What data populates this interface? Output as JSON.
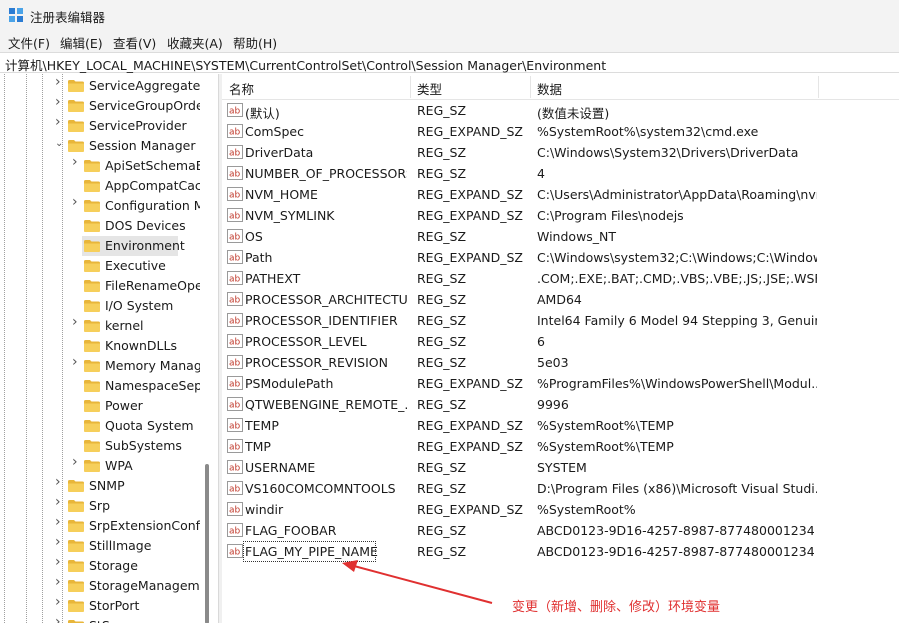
{
  "window": {
    "title": "注册表编辑器"
  },
  "menu": [
    "文件(F)",
    "编辑(E)",
    "查看(V)",
    "收藏夹(A)",
    "帮助(H)"
  ],
  "address": "计算机\\HKEY_LOCAL_MACHINE\\SYSTEM\\CurrentControlSet\\Control\\Session Manager\\Environment",
  "tree": [
    {
      "label": "ServiceAggregatedEvents",
      "level": 1,
      "chevron": "right"
    },
    {
      "label": "ServiceGroupOrder",
      "level": 1,
      "chevron": "right"
    },
    {
      "label": "ServiceProvider",
      "level": 1,
      "chevron": "right"
    },
    {
      "label": "Session Manager",
      "level": 1,
      "chevron": "down"
    },
    {
      "label": "ApiSetSchemaExtensions",
      "level": 2,
      "chevron": "right"
    },
    {
      "label": "AppCompatCache",
      "level": 2,
      "chevron": ""
    },
    {
      "label": "Configuration Manager",
      "level": 2,
      "chevron": "right"
    },
    {
      "label": "DOS Devices",
      "level": 2,
      "chevron": ""
    },
    {
      "label": "Environment",
      "level": 2,
      "chevron": "",
      "selected": true
    },
    {
      "label": "Executive",
      "level": 2,
      "chevron": ""
    },
    {
      "label": "FileRenameOperations",
      "level": 2,
      "chevron": ""
    },
    {
      "label": "I/O System",
      "level": 2,
      "chevron": ""
    },
    {
      "label": "kernel",
      "level": 2,
      "chevron": "right"
    },
    {
      "label": "KnownDLLs",
      "level": 2,
      "chevron": ""
    },
    {
      "label": "Memory Management",
      "level": 2,
      "chevron": "right"
    },
    {
      "label": "NamespaceSeparation",
      "level": 2,
      "chevron": ""
    },
    {
      "label": "Power",
      "level": 2,
      "chevron": ""
    },
    {
      "label": "Quota System",
      "level": 2,
      "chevron": ""
    },
    {
      "label": "SubSystems",
      "level": 2,
      "chevron": ""
    },
    {
      "label": "WPA",
      "level": 2,
      "chevron": "right"
    },
    {
      "label": "SNMP",
      "level": 1,
      "chevron": "right"
    },
    {
      "label": "Srp",
      "level": 1,
      "chevron": "right"
    },
    {
      "label": "SrpExtensionConfig",
      "level": 1,
      "chevron": "right"
    },
    {
      "label": "StillImage",
      "level": 1,
      "chevron": "right"
    },
    {
      "label": "Storage",
      "level": 1,
      "chevron": "right"
    },
    {
      "label": "StorageManagement",
      "level": 1,
      "chevron": "right"
    },
    {
      "label": "StorPort",
      "level": 1,
      "chevron": "right"
    },
    {
      "label": "StSec",
      "level": 1,
      "chevron": "right"
    }
  ],
  "columns": {
    "name": "名称",
    "type": "类型",
    "data": "数据"
  },
  "rows": [
    {
      "name": "(默认)",
      "type": "REG_SZ",
      "data": "(数值未设置)"
    },
    {
      "name": "ComSpec",
      "type": "REG_EXPAND_SZ",
      "data": "%SystemRoot%\\system32\\cmd.exe"
    },
    {
      "name": "DriverData",
      "type": "REG_SZ",
      "data": "C:\\Windows\\System32\\Drivers\\DriverData"
    },
    {
      "name": "NUMBER_OF_PROCESSORS",
      "type": "REG_SZ",
      "data": "4"
    },
    {
      "name": "NVM_HOME",
      "type": "REG_EXPAND_SZ",
      "data": "C:\\Users\\Administrator\\AppData\\Roaming\\nvm"
    },
    {
      "name": "NVM_SYMLINK",
      "type": "REG_EXPAND_SZ",
      "data": "C:\\Program Files\\nodejs"
    },
    {
      "name": "OS",
      "type": "REG_SZ",
      "data": "Windows_NT"
    },
    {
      "name": "Path",
      "type": "REG_EXPAND_SZ",
      "data": "C:\\Windows\\system32;C:\\Windows;C:\\Window..."
    },
    {
      "name": "PATHEXT",
      "type": "REG_SZ",
      "data": ".COM;.EXE;.BAT;.CMD;.VBS;.VBE;.JS;.JSE;.WSF;...."
    },
    {
      "name": "PROCESSOR_ARCHITECTU...",
      "type": "REG_SZ",
      "data": "AMD64"
    },
    {
      "name": "PROCESSOR_IDENTIFIER",
      "type": "REG_SZ",
      "data": "Intel64 Family 6 Model 94 Stepping 3, Genuin..."
    },
    {
      "name": "PROCESSOR_LEVEL",
      "type": "REG_SZ",
      "data": "6"
    },
    {
      "name": "PROCESSOR_REVISION",
      "type": "REG_SZ",
      "data": "5e03"
    },
    {
      "name": "PSModulePath",
      "type": "REG_EXPAND_SZ",
      "data": "%ProgramFiles%\\WindowsPowerShell\\Modul..."
    },
    {
      "name": "QTWEBENGINE_REMOTE_...",
      "type": "REG_SZ",
      "data": "9996"
    },
    {
      "name": "TEMP",
      "type": "REG_EXPAND_SZ",
      "data": "%SystemRoot%\\TEMP"
    },
    {
      "name": "TMP",
      "type": "REG_EXPAND_SZ",
      "data": "%SystemRoot%\\TEMP"
    },
    {
      "name": "USERNAME",
      "type": "REG_SZ",
      "data": "SYSTEM"
    },
    {
      "name": "VS160COMCOMNTOOLS",
      "type": "REG_SZ",
      "data": "D:\\Program Files (x86)\\Microsoft Visual Studi..."
    },
    {
      "name": "windir",
      "type": "REG_EXPAND_SZ",
      "data": "%SystemRoot%"
    },
    {
      "name": "FLAG_FOOBAR",
      "type": "REG_SZ",
      "data": "ABCD0123-9D16-4257-8987-877480001234"
    },
    {
      "name": "FLAG_MY_PIPE_NAME",
      "type": "REG_SZ",
      "data": "ABCD0123-9D16-4257-8987-877480001234",
      "focused": true
    }
  ],
  "annotation": "变更（新增、删除、修改）环境变量",
  "colors": {
    "annotation": "#e03030",
    "folder": "#f0c54a",
    "selection": "#e5e5e5"
  },
  "icons": {
    "app": "registry-editor-icon",
    "folder": "folder-icon",
    "value": "string-value-icon",
    "chevron": "chevron-icon"
  }
}
